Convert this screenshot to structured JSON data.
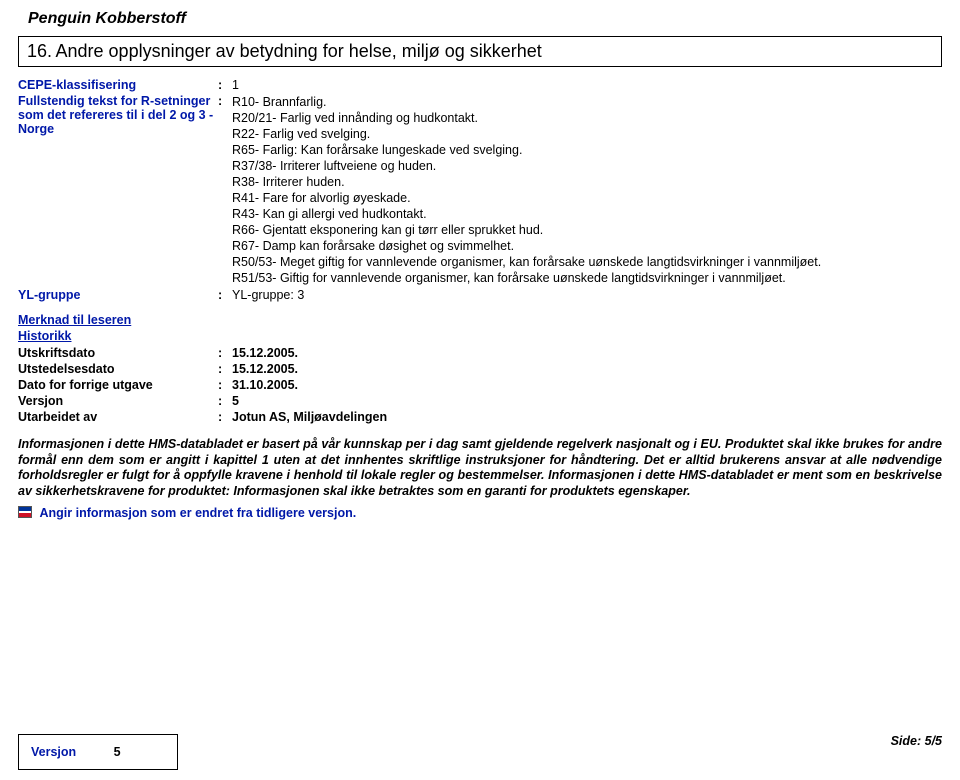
{
  "product_title": "Penguin Kobberstoff",
  "section": {
    "num": "16.",
    "title": "Andre opplysninger av betydning for helse, miljø og sikkerhet"
  },
  "rows": {
    "cepe": {
      "label": "CEPE-klassifisering",
      "value": "1"
    },
    "rsent": {
      "label": "Fullstendig tekst for R-setninger som det refereres til i del 2 og 3 - Norge",
      "lines": [
        "R10- Brannfarlig.",
        "R20/21- Farlig ved innånding og hudkontakt.",
        "R22- Farlig ved svelging.",
        "R65- Farlig: Kan forårsake lungeskade ved svelging.",
        "R37/38- Irriterer luftveiene og huden.",
        "R38- Irriterer huden.",
        "R41- Fare for alvorlig øyeskade.",
        "R43- Kan gi allergi ved hudkontakt.",
        "R66- Gjentatt eksponering kan gi tørr eller sprukket hud.",
        "R67- Damp kan forårsake døsighet og svimmelhet.",
        "R50/53- Meget giftig for vannlevende organismer, kan forårsake uønskede langtidsvirkninger i vannmiljøet.",
        "R51/53- Giftig for vannlevende organismer, kan forårsake uønskede langtidsvirkninger i vannmiljøet."
      ]
    },
    "yl": {
      "label": "YL-gruppe",
      "value": "YL-gruppe: 3"
    }
  },
  "subheaders": {
    "merknad": "Merknad til leseren",
    "historikk": "Historikk"
  },
  "hist": {
    "utskriftsdato": {
      "label": "Utskriftsdato",
      "value": "15.12.2005."
    },
    "utstedelsesdato": {
      "label": "Utstedelsesdato",
      "value": "15.12.2005."
    },
    "forrige": {
      "label": "Dato for forrige utgave",
      "value": "31.10.2005."
    },
    "versjon": {
      "label": "Versjon",
      "value": "5"
    },
    "utarbeidet": {
      "label": "Utarbeidet av",
      "value": "Jotun AS, Miljøavdelingen"
    }
  },
  "info_para": "Informasjonen i dette HMS-databladet er basert på vår kunnskap per i dag samt gjeldende regelverk nasjonalt og i EU. Produktet skal ikke brukes for andre formål enn dem som er angitt i kapittel 1 uten at det innhentes skriftlige instruksjoner for håndtering. Det er alltid brukerens ansvar at alle nødvendige forholdsregler er fulgt for å oppfylle kravene i henhold til lokale regler og bestemmelser. Informasjonen i dette HMS-databladet er ment som en beskrivelse av sikkerhetskravene for produktet: Informasjonen skal ikke betraktes som en garanti for produktets egenskaper.",
  "flag_note": "Angir informasjon som er endret fra tidligere versjon.",
  "footer": {
    "versjon_label": "Versjon",
    "versjon_value": "5",
    "page": "Side: 5/5"
  }
}
